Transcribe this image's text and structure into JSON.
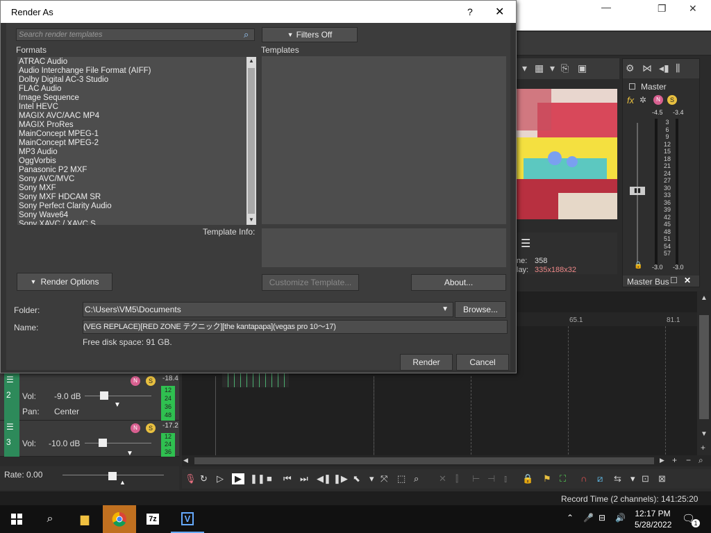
{
  "app": {
    "master_label": "Master",
    "master_bus_label": "Master Bus",
    "meter_scale": [
      "-4.5",
      "-3.4",
      "3",
      "6",
      "9",
      "12",
      "15",
      "18",
      "21",
      "24",
      "27",
      "30",
      "33",
      "36",
      "39",
      "42",
      "45",
      "48",
      "51",
      "54",
      "57"
    ],
    "meter_bottom": [
      "-3.0",
      "-3.0"
    ],
    "video_info": {
      "frame_label": "ne:",
      "frame_value": "358",
      "display_label": "lay:",
      "display_value": "335x188x32"
    },
    "timeline_markers": [
      "65.1",
      "81.1"
    ],
    "tracks": [
      {
        "num": "2",
        "vol_label": "Vol:",
        "vol": "-9.0 dB",
        "pan_label": "Pan:",
        "pan": "Center",
        "peak": "-18.4",
        "meter": [
          "12",
          "24",
          "36",
          "48"
        ]
      },
      {
        "num": "3",
        "vol_label": "Vol:",
        "vol": "-10.0 dB",
        "peak": "-17.2",
        "meter": [
          "12",
          "24",
          "36"
        ]
      }
    ],
    "rate_label": "Rate: 0.00",
    "status_record": "Record Time (2 channels): 141:25:20"
  },
  "taskbar": {
    "time": "12:17 PM",
    "date": "5/28/2022",
    "notif_count": "1",
    "items": [
      "windows-start",
      "search",
      "file-explorer",
      "chrome",
      "7zip",
      "vegas"
    ]
  },
  "dialog": {
    "title": "Render As",
    "help": "?",
    "close": "✕",
    "search_placeholder": "Search render templates",
    "filters_label": "Filters Off",
    "formats_label": "Formats",
    "templates_label": "Templates",
    "formats": [
      "ATRAC Audio",
      "Audio Interchange File Format (AIFF)",
      "Dolby Digital AC-3 Studio",
      "FLAC Audio",
      "Image Sequence",
      "Intel HEVC",
      "MAGIX AVC/AAC MP4",
      "MAGIX ProRes",
      "MainConcept MPEG-1",
      "MainConcept MPEG-2",
      "MP3 Audio",
      "OggVorbis",
      "Panasonic P2 MXF",
      "Sony AVC/MVC",
      "Sony MXF",
      "Sony MXF HDCAM SR",
      "Sony Perfect Clarity Audio",
      "Sony Wave64",
      "Sony XAVC / XAVC S"
    ],
    "template_info_label": "Template Info:",
    "render_options_label": "Render Options",
    "customize_label": "Customize Template...",
    "about_label": "About...",
    "folder_label": "Folder:",
    "folder_value": "C:\\Users\\VM5\\Documents",
    "browse_label": "Browse...",
    "name_label": "Name:",
    "name_value": "(VEG REPLACE)[RED ZONE テクニック][the kantapapa](vegas pro 10～17)",
    "free_space": "Free disk space: 91 GB.",
    "render_label": "Render",
    "cancel_label": "Cancel"
  }
}
